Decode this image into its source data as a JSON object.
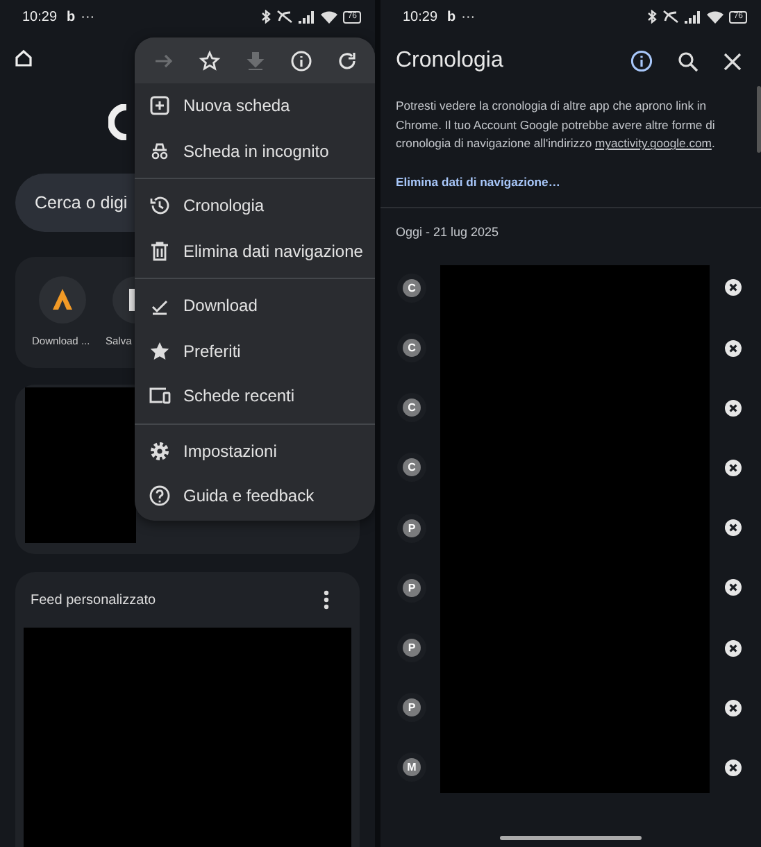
{
  "left_screen": {
    "status_bar": {
      "time": "10:29",
      "app_letter": "b",
      "dots": "···",
      "battery": "76"
    },
    "search": {
      "placeholder": "Cerca o digi"
    },
    "shortcuts": [
      {
        "label": "Download ..."
      },
      {
        "label": "Salva"
      }
    ],
    "feed_card": {
      "title": "Feed personalizzato"
    },
    "menu": {
      "toolbar": [
        {
          "kind": "forward",
          "disabled": true
        },
        {
          "kind": "bookmark",
          "disabled": false
        },
        {
          "kind": "download",
          "disabled": true
        },
        {
          "kind": "info",
          "disabled": false
        },
        {
          "kind": "reload",
          "disabled": false
        }
      ],
      "groups": [
        [
          {
            "label": "Nuova scheda"
          },
          {
            "label": "Scheda in incognito"
          }
        ],
        [
          {
            "label": "Cronologia"
          },
          {
            "label": "Elimina dati navigazione"
          }
        ],
        [
          {
            "label": "Download"
          },
          {
            "label": "Preferiti"
          },
          {
            "label": "Schede recenti"
          }
        ],
        [
          {
            "label": "Impostazioni"
          },
          {
            "label": "Guida e feedback"
          }
        ]
      ]
    }
  },
  "right_screen": {
    "status_bar": {
      "time": "10:29",
      "app_letter": "b",
      "dots": "···",
      "battery": "76"
    },
    "title": "Cronologia",
    "notice": "Potresti vedere la cronologia di altre app che aprono link in Chrome. Il tuo Account Google potrebbe avere altre forme di cronologia di navigazione all'indirizzo",
    "notice_link": "myactivity.google.com",
    "notice_end": ".",
    "clear_link": "Elimina dati di navigazione…",
    "date_header": "Oggi - 21 lug 2025",
    "entries": [
      {
        "letter": "C"
      },
      {
        "letter": "C"
      },
      {
        "letter": "C"
      },
      {
        "letter": "C"
      },
      {
        "letter": "P"
      },
      {
        "letter": "P"
      },
      {
        "letter": "P"
      },
      {
        "letter": "P"
      },
      {
        "letter": "M"
      }
    ]
  }
}
